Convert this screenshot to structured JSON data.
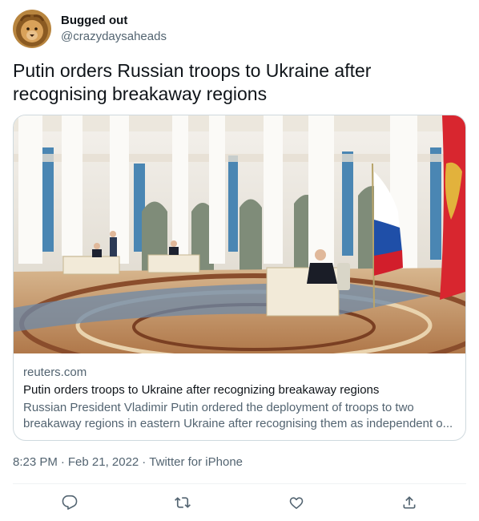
{
  "user": {
    "display_name": "Bugged out",
    "handle": "@crazydaysaheads",
    "avatar_icon": "lion-avatar"
  },
  "tweet": {
    "text": "Putin orders Russian troops to Ukraine after recognising breakaway regions"
  },
  "card": {
    "domain": "reuters.com",
    "title": "Putin orders troops to Ukraine after recognizing breakaway regions",
    "description_line1": "Russian President Vladimir Putin ordered the deployment of troops to two",
    "description_line2": "breakaway regions in eastern Ukraine after recognising them as independent o..."
  },
  "meta": {
    "time": "8:23 PM",
    "separator": "·",
    "date": "Feb 21, 2022",
    "source": "Twitter for iPhone"
  },
  "actions": {
    "icons": [
      "reply-icon",
      "retweet-icon",
      "like-icon",
      "share-icon"
    ],
    "color": "#536471"
  },
  "colors": {
    "text_primary": "#0f1419",
    "text_secondary": "#536471",
    "border": "#cfd9de"
  }
}
